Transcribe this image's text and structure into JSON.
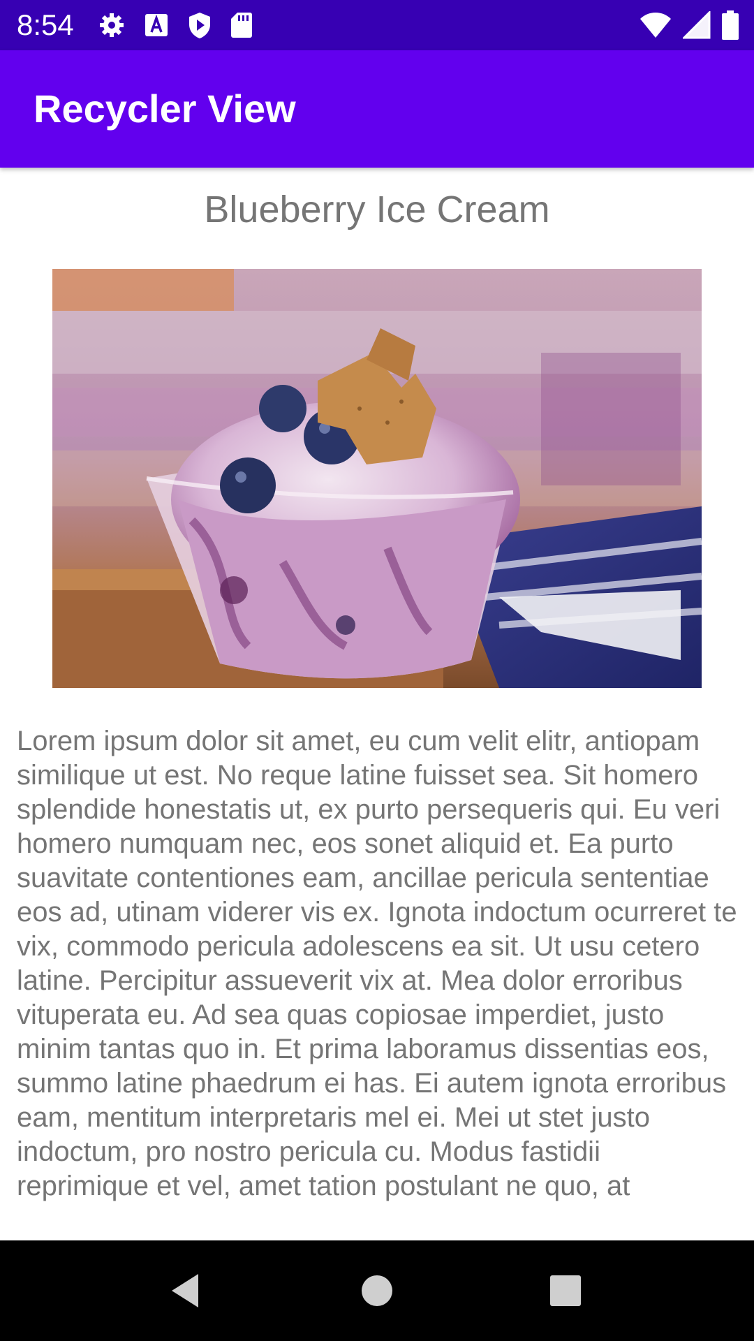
{
  "status_bar": {
    "time": "8:54",
    "icons_left": [
      "gear-icon",
      "font-a-icon",
      "shield-play-icon",
      "sd-card-icon"
    ],
    "icons_right": [
      "wifi-icon",
      "signal-icon",
      "battery-icon"
    ]
  },
  "app_bar": {
    "title": "Recycler View",
    "color": "#6200EE",
    "status_color": "#3700B3"
  },
  "item": {
    "title": "Blueberry Ice Cream",
    "image": "blueberry-ice-cream-photo",
    "body": "Lorem ipsum dolor sit amet, eu cum velit elitr, antiopam similique ut est. No reque latine fuisset sea. Sit homero splendide honestatis ut, ex purto persequeris qui. Eu veri homero numquam nec, eos sonet aliquid et. Ea purto suavitate contentiones eam, ancillae pericula sententiae eos ad, utinam viderer vis ex. Ignota indoctum ocurreret te vix, commodo pericula adolescens ea sit. Ut usu cetero latine. Percipitur assueverit vix at. Mea dolor erroribus vituperata eu. Ad sea quas copiosae imperdiet, justo minim tantas quo in. Et prima laboramus dissentias eos, summo latine phaedrum ei has. Ei autem ignota erroribus eam, mentitum interpretaris mel ei. Mei ut stet justo indoctum, pro nostro pericula cu. Modus fastidii reprimique et vel, amet tation postulant ne quo, at"
  },
  "nav_bar": {
    "buttons": [
      "back-icon",
      "home-icon",
      "recents-icon"
    ]
  }
}
